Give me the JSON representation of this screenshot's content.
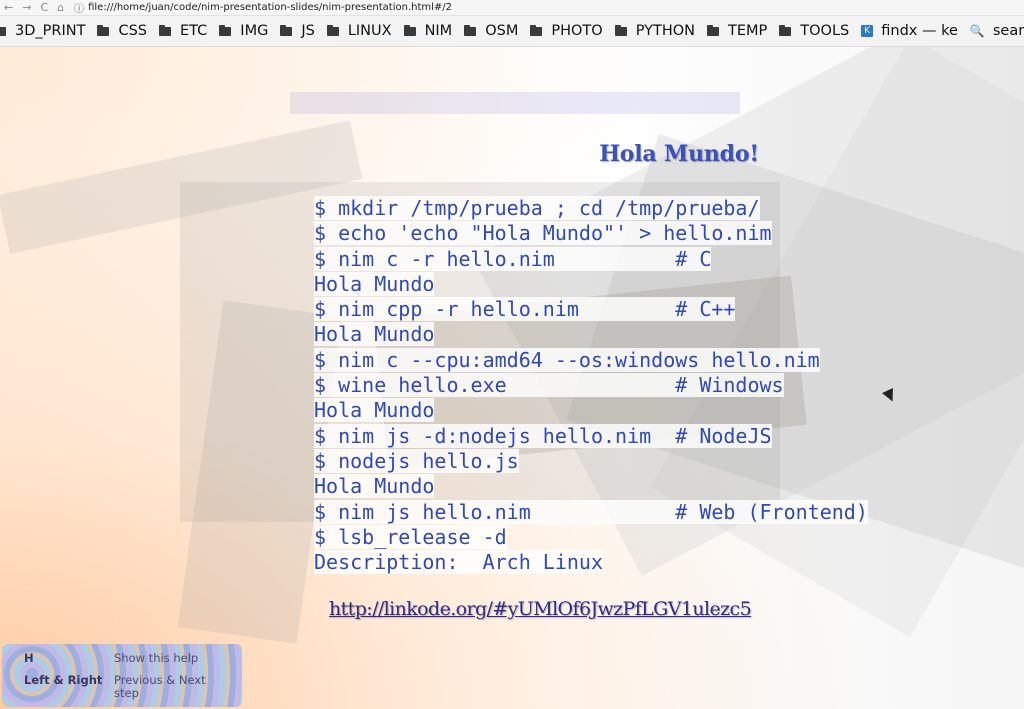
{
  "browser": {
    "back_icon": "←",
    "forward_icon": "→",
    "reload_icon": "C",
    "home_icon": "⌂",
    "info_icon": "ⓘ",
    "url": "file:///home/juan/code/nim-presentation-slides/nim-presentation.html#/2"
  },
  "bookmarks": [
    {
      "label": "3D_PRINT",
      "icon": "folder-icon"
    },
    {
      "label": "CSS",
      "icon": "folder-icon"
    },
    {
      "label": "ETC",
      "icon": "folder-icon"
    },
    {
      "label": "IMG",
      "icon": "folder-icon"
    },
    {
      "label": "JS",
      "icon": "folder-icon"
    },
    {
      "label": "LINUX",
      "icon": "folder-icon"
    },
    {
      "label": "NIM",
      "icon": "folder-icon"
    },
    {
      "label": "OSM",
      "icon": "folder-icon"
    },
    {
      "label": "PHOTO",
      "icon": "folder-icon"
    },
    {
      "label": "PYTHON",
      "icon": "folder-icon"
    },
    {
      "label": "TEMP",
      "icon": "folder-icon"
    },
    {
      "label": "TOOLS",
      "icon": "folder-icon"
    }
  ],
  "extra_bookmarks": {
    "findx_label": "findx — ke",
    "findx_icon": "K",
    "searx_label": "searx.me",
    "searx_icon": "🔍",
    "overflow_icon": "T"
  },
  "slide": {
    "title": "Hola Mundo!",
    "code_lines": [
      "$ mkdir /tmp/prueba ; cd /tmp/prueba/",
      "$ echo 'echo \"Hola Mundo\"' > hello.nim",
      "$ nim c -r hello.nim          # C",
      "Hola Mundo",
      "$ nim cpp -r hello.nim        # C++",
      "Hola Mundo",
      "$ nim c --cpu:amd64 --os:windows hello.nim",
      "$ wine hello.exe              # Windows",
      "Hola Mundo",
      "$ nim js -d:nodejs hello.nim  # NodeJS",
      "$ nodejs hello.js",
      "Hola Mundo",
      "$ nim js hello.nim            # Web (Frontend)",
      "$ lsb_release -d",
      "Description:  Arch Linux"
    ],
    "link": "http://linkode.org/#yUMlOf6JwzPfLGV1ulezc5"
  },
  "help": {
    "key1": "H",
    "desc1": "Show this help",
    "key2": "Left & Right",
    "desc2": "Previous & Next step"
  }
}
